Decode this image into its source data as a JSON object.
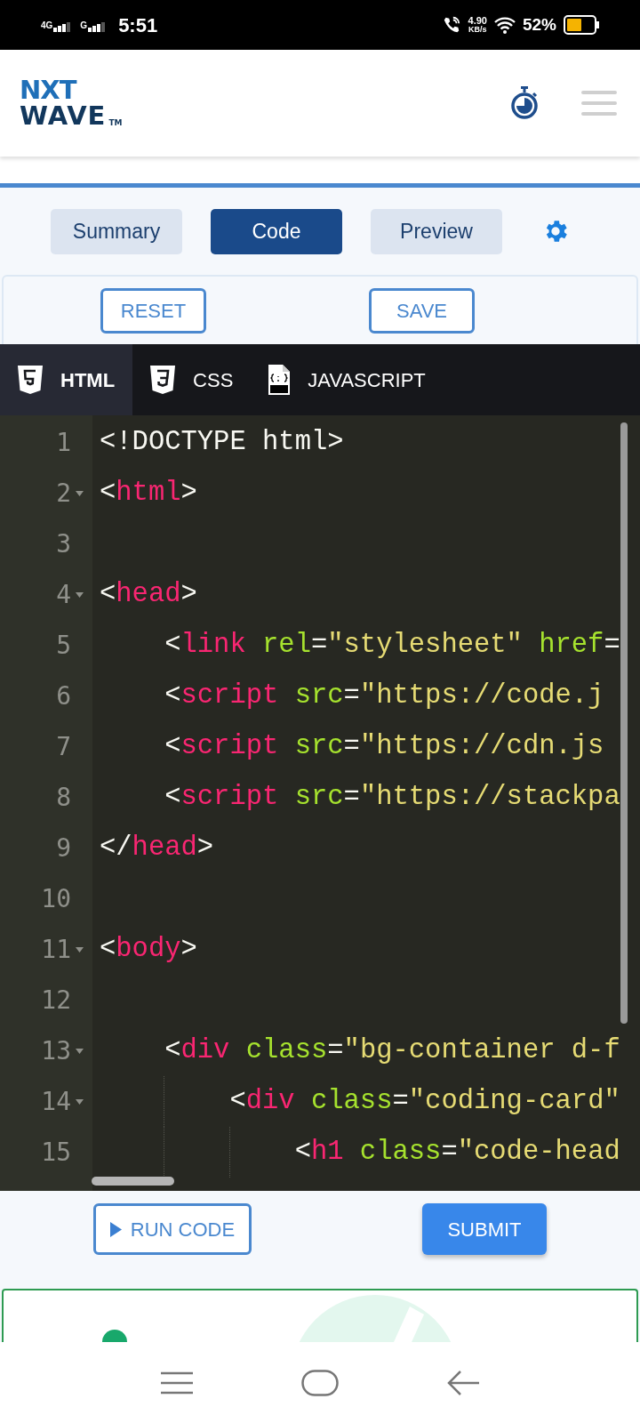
{
  "status_bar": {
    "network_1": "4G",
    "network_2": "G",
    "time": "5:51",
    "speed": "4.90",
    "speed_unit": "KB/s",
    "battery": "52%"
  },
  "header": {
    "logo_top": "NXT",
    "logo_bottom": "WAVE",
    "logo_mark": "TM"
  },
  "view_tabs": [
    {
      "label": "Summary",
      "selected": false
    },
    {
      "label": "Code",
      "selected": true
    },
    {
      "label": "Preview",
      "selected": false
    }
  ],
  "editor_actions": [
    "RESET",
    "SAVE"
  ],
  "file_tabs": [
    {
      "label": "HTML",
      "kind": "html",
      "selected": true
    },
    {
      "label": "CSS",
      "kind": "css",
      "selected": false
    },
    {
      "label": "JAVASCRIPT",
      "kind": "js",
      "selected": false
    }
  ],
  "code_lines": [
    {
      "number": "1",
      "foldable": false,
      "tokens": [
        {
          "kind": "text",
          "text": "<!DOCTYPE html>"
        }
      ]
    },
    {
      "number": "2",
      "foldable": true,
      "tokens": [
        {
          "kind": "text",
          "text": "<"
        },
        {
          "kind": "tag",
          "text": "html"
        },
        {
          "kind": "text",
          "text": ">"
        }
      ]
    },
    {
      "number": "3",
      "foldable": false
    },
    {
      "number": "4",
      "foldable": true,
      "tokens": [
        {
          "kind": "text",
          "text": "<"
        },
        {
          "kind": "tag",
          "text": "head"
        },
        {
          "kind": "text",
          "text": ">"
        }
      ]
    },
    {
      "number": "5",
      "foldable": false,
      "tokens": [
        {
          "kind": "text",
          "text": "    <"
        },
        {
          "kind": "tag",
          "text": "link"
        },
        {
          "kind": "attr",
          "text": " rel"
        },
        {
          "kind": "text",
          "text": "="
        },
        {
          "kind": "string",
          "text": "\"stylesheet\""
        },
        {
          "kind": "attr",
          "text": " href"
        },
        {
          "kind": "text",
          "text": "="
        }
      ]
    },
    {
      "number": "6",
      "foldable": false,
      "tokens": [
        {
          "kind": "text",
          "text": "    <"
        },
        {
          "kind": "tag",
          "text": "script"
        },
        {
          "kind": "attr",
          "text": " src"
        },
        {
          "kind": "text",
          "text": "="
        },
        {
          "kind": "string",
          "text": "\"https://code.j"
        }
      ]
    },
    {
      "number": "7",
      "foldable": false,
      "tokens": [
        {
          "kind": "text",
          "text": "    <"
        },
        {
          "kind": "tag",
          "text": "script"
        },
        {
          "kind": "attr",
          "text": " src"
        },
        {
          "kind": "text",
          "text": "="
        },
        {
          "kind": "string",
          "text": "\"https://cdn.js"
        }
      ]
    },
    {
      "number": "8",
      "foldable": false,
      "tokens": [
        {
          "kind": "text",
          "text": "    <"
        },
        {
          "kind": "tag",
          "text": "script"
        },
        {
          "kind": "attr",
          "text": " src"
        },
        {
          "kind": "text",
          "text": "="
        },
        {
          "kind": "string",
          "text": "\"https://stackpa"
        }
      ]
    },
    {
      "number": "9",
      "foldable": false,
      "tokens": [
        {
          "kind": "text",
          "text": "</"
        },
        {
          "kind": "tag",
          "text": "head"
        },
        {
          "kind": "text",
          "text": ">"
        }
      ]
    },
    {
      "number": "10",
      "foldable": false
    },
    {
      "number": "11",
      "foldable": true,
      "tokens": [
        {
          "kind": "text",
          "text": "<"
        },
        {
          "kind": "tag",
          "text": "body"
        },
        {
          "kind": "text",
          "text": ">"
        }
      ]
    },
    {
      "number": "12",
      "foldable": false
    },
    {
      "number": "13",
      "foldable": true,
      "tokens": [
        {
          "kind": "text",
          "text": "    <"
        },
        {
          "kind": "tag",
          "text": "div"
        },
        {
          "kind": "attr",
          "text": " class"
        },
        {
          "kind": "text",
          "text": "="
        },
        {
          "kind": "string",
          "text": "\"bg-container d-f"
        }
      ]
    },
    {
      "number": "14",
      "foldable": true,
      "tokens": [
        {
          "kind": "text",
          "text": "        <"
        },
        {
          "kind": "tag",
          "text": "div"
        },
        {
          "kind": "attr",
          "text": " class"
        },
        {
          "kind": "text",
          "text": "="
        },
        {
          "kind": "string",
          "text": "\"coding-card\""
        }
      ]
    },
    {
      "number": "15",
      "foldable": false,
      "tokens": [
        {
          "kind": "text",
          "text": "            <"
        },
        {
          "kind": "tag",
          "text": "h1"
        },
        {
          "kind": "attr",
          "text": " class"
        },
        {
          "kind": "text",
          "text": "="
        },
        {
          "kind": "string",
          "text": "\"code-head"
        }
      ]
    }
  ],
  "run_button": "RUN CODE",
  "submit_button": "SUBMIT"
}
